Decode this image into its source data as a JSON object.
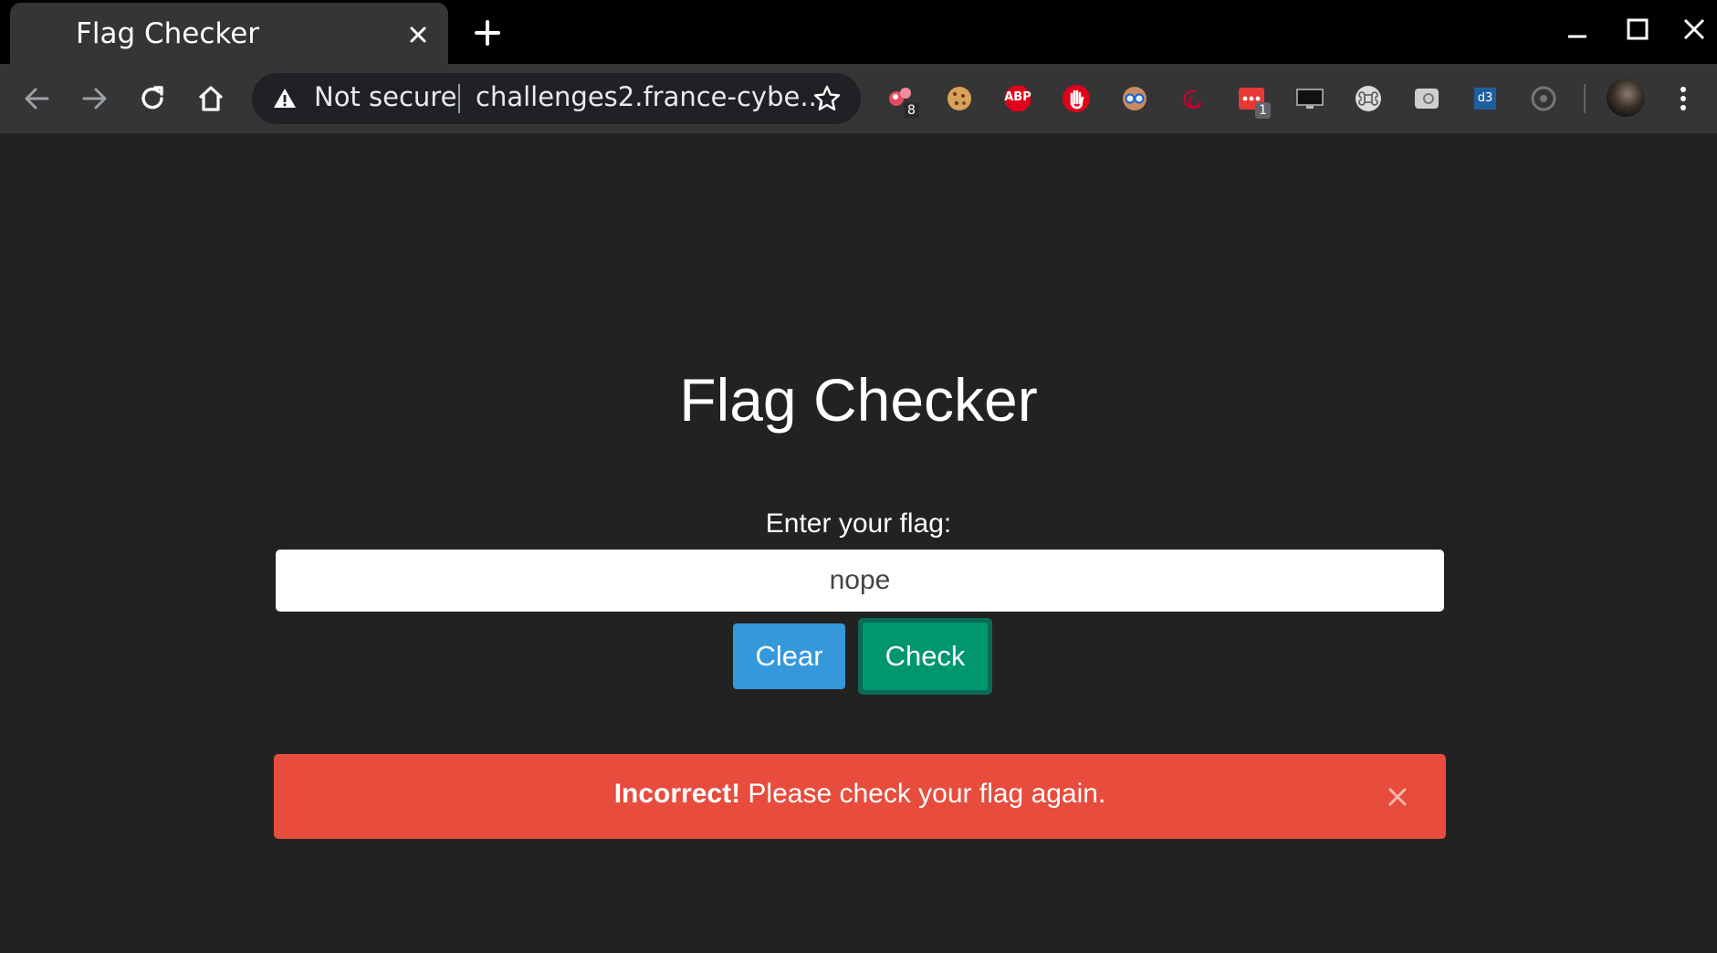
{
  "browser": {
    "tab_title": "Flag Checker",
    "omnibox": {
      "security_label": "Not secure",
      "url": "challenges2.france-cybe..."
    },
    "extensions": [
      {
        "name": "extension-1",
        "badge": "8"
      },
      {
        "name": "cookie-extension"
      },
      {
        "name": "adblock-plus-extension",
        "label": "ABP"
      },
      {
        "name": "hand-stop-extension"
      },
      {
        "name": "glasses-face-extension"
      },
      {
        "name": "debian-swirl-extension"
      },
      {
        "name": "red-dots-extension",
        "badge": "1"
      },
      {
        "name": "monitor-extension"
      },
      {
        "name": "command-key-extension"
      },
      {
        "name": "grey-badge-extension"
      },
      {
        "name": "d3-extension",
        "label": "d3"
      },
      {
        "name": "grey-circle-extension"
      }
    ],
    "colors": {
      "tabbar": "#000000",
      "toolbar": "#353535",
      "omnibox": "#202124"
    }
  },
  "page": {
    "title": "Flag Checker",
    "input_label": "Enter your flag:",
    "input_value": "nope",
    "clear_label": "Clear",
    "check_label": "Check",
    "alert": {
      "strong": "Incorrect!",
      "message": " Please check your flag again.",
      "close_symbol": "×"
    },
    "colors": {
      "background": "#222222",
      "clear_button": "#3498db",
      "check_button": "#00966f",
      "alert": "#e74c3c"
    }
  }
}
